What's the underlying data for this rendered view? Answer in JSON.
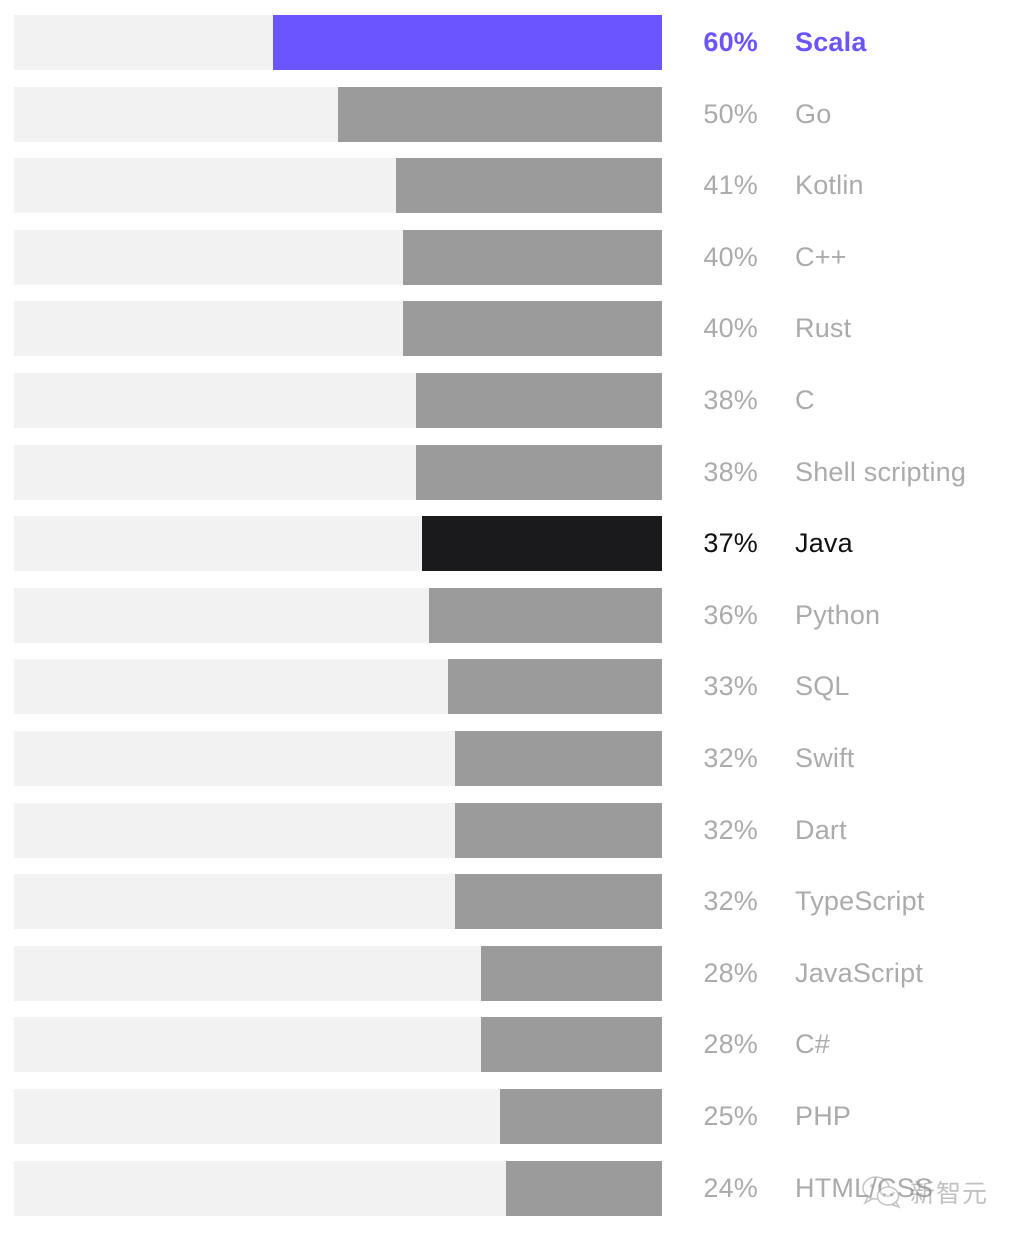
{
  "chart_data": {
    "type": "bar",
    "title": "",
    "subtitle": "",
    "xlabel": "",
    "ylabel": "",
    "orientation": "horizontal",
    "grid": false,
    "legend": null,
    "xlim": [
      0,
      100
    ],
    "value_suffix": "%",
    "track_color": "#f2f2f2",
    "bar_color": "#9b9b9b",
    "highlight_color": "#6a55ff",
    "accent_color": "#1a1a1d",
    "label_color": "#ababab",
    "background": "#ffffff",
    "categories": [
      "Scala",
      "Go",
      "Kotlin",
      "C++",
      "Rust",
      "C",
      "Shell scripting",
      "Java",
      "Python",
      "SQL",
      "Swift",
      "Dart",
      "TypeScript",
      "JavaScript",
      "C#",
      "PHP",
      "HTML/CSS"
    ],
    "values": [
      60,
      50,
      41,
      40,
      40,
      38,
      38,
      37,
      36,
      33,
      32,
      32,
      32,
      28,
      28,
      25,
      24
    ],
    "rows": [
      {
        "pct": "60%",
        "value": 60,
        "label": "Scala",
        "style": "highlight"
      },
      {
        "pct": "50%",
        "value": 50,
        "label": "Go",
        "style": "normal"
      },
      {
        "pct": "41%",
        "value": 41,
        "label": "Kotlin",
        "style": "normal"
      },
      {
        "pct": "40%",
        "value": 40,
        "label": "C++",
        "style": "normal"
      },
      {
        "pct": "40%",
        "value": 40,
        "label": "Rust",
        "style": "normal"
      },
      {
        "pct": "38%",
        "value": 38,
        "label": "C",
        "style": "normal"
      },
      {
        "pct": "38%",
        "value": 38,
        "label": "Shell scripting",
        "style": "normal"
      },
      {
        "pct": "37%",
        "value": 37,
        "label": "Java",
        "style": "accent"
      },
      {
        "pct": "36%",
        "value": 36,
        "label": "Python",
        "style": "normal"
      },
      {
        "pct": "33%",
        "value": 33,
        "label": "SQL",
        "style": "normal"
      },
      {
        "pct": "32%",
        "value": 32,
        "label": "Swift",
        "style": "normal"
      },
      {
        "pct": "32%",
        "value": 32,
        "label": "Dart",
        "style": "normal"
      },
      {
        "pct": "32%",
        "value": 32,
        "label": "TypeScript",
        "style": "normal"
      },
      {
        "pct": "28%",
        "value": 28,
        "label": "JavaScript",
        "style": "normal"
      },
      {
        "pct": "28%",
        "value": 28,
        "label": "C#",
        "style": "normal"
      },
      {
        "pct": "25%",
        "value": 25,
        "label": "PHP",
        "style": "normal"
      },
      {
        "pct": "24%",
        "value": 24,
        "label": "HTML/CSS",
        "style": "normal"
      }
    ]
  },
  "watermark": {
    "icon": "wechat-icon",
    "text": "新智元"
  }
}
